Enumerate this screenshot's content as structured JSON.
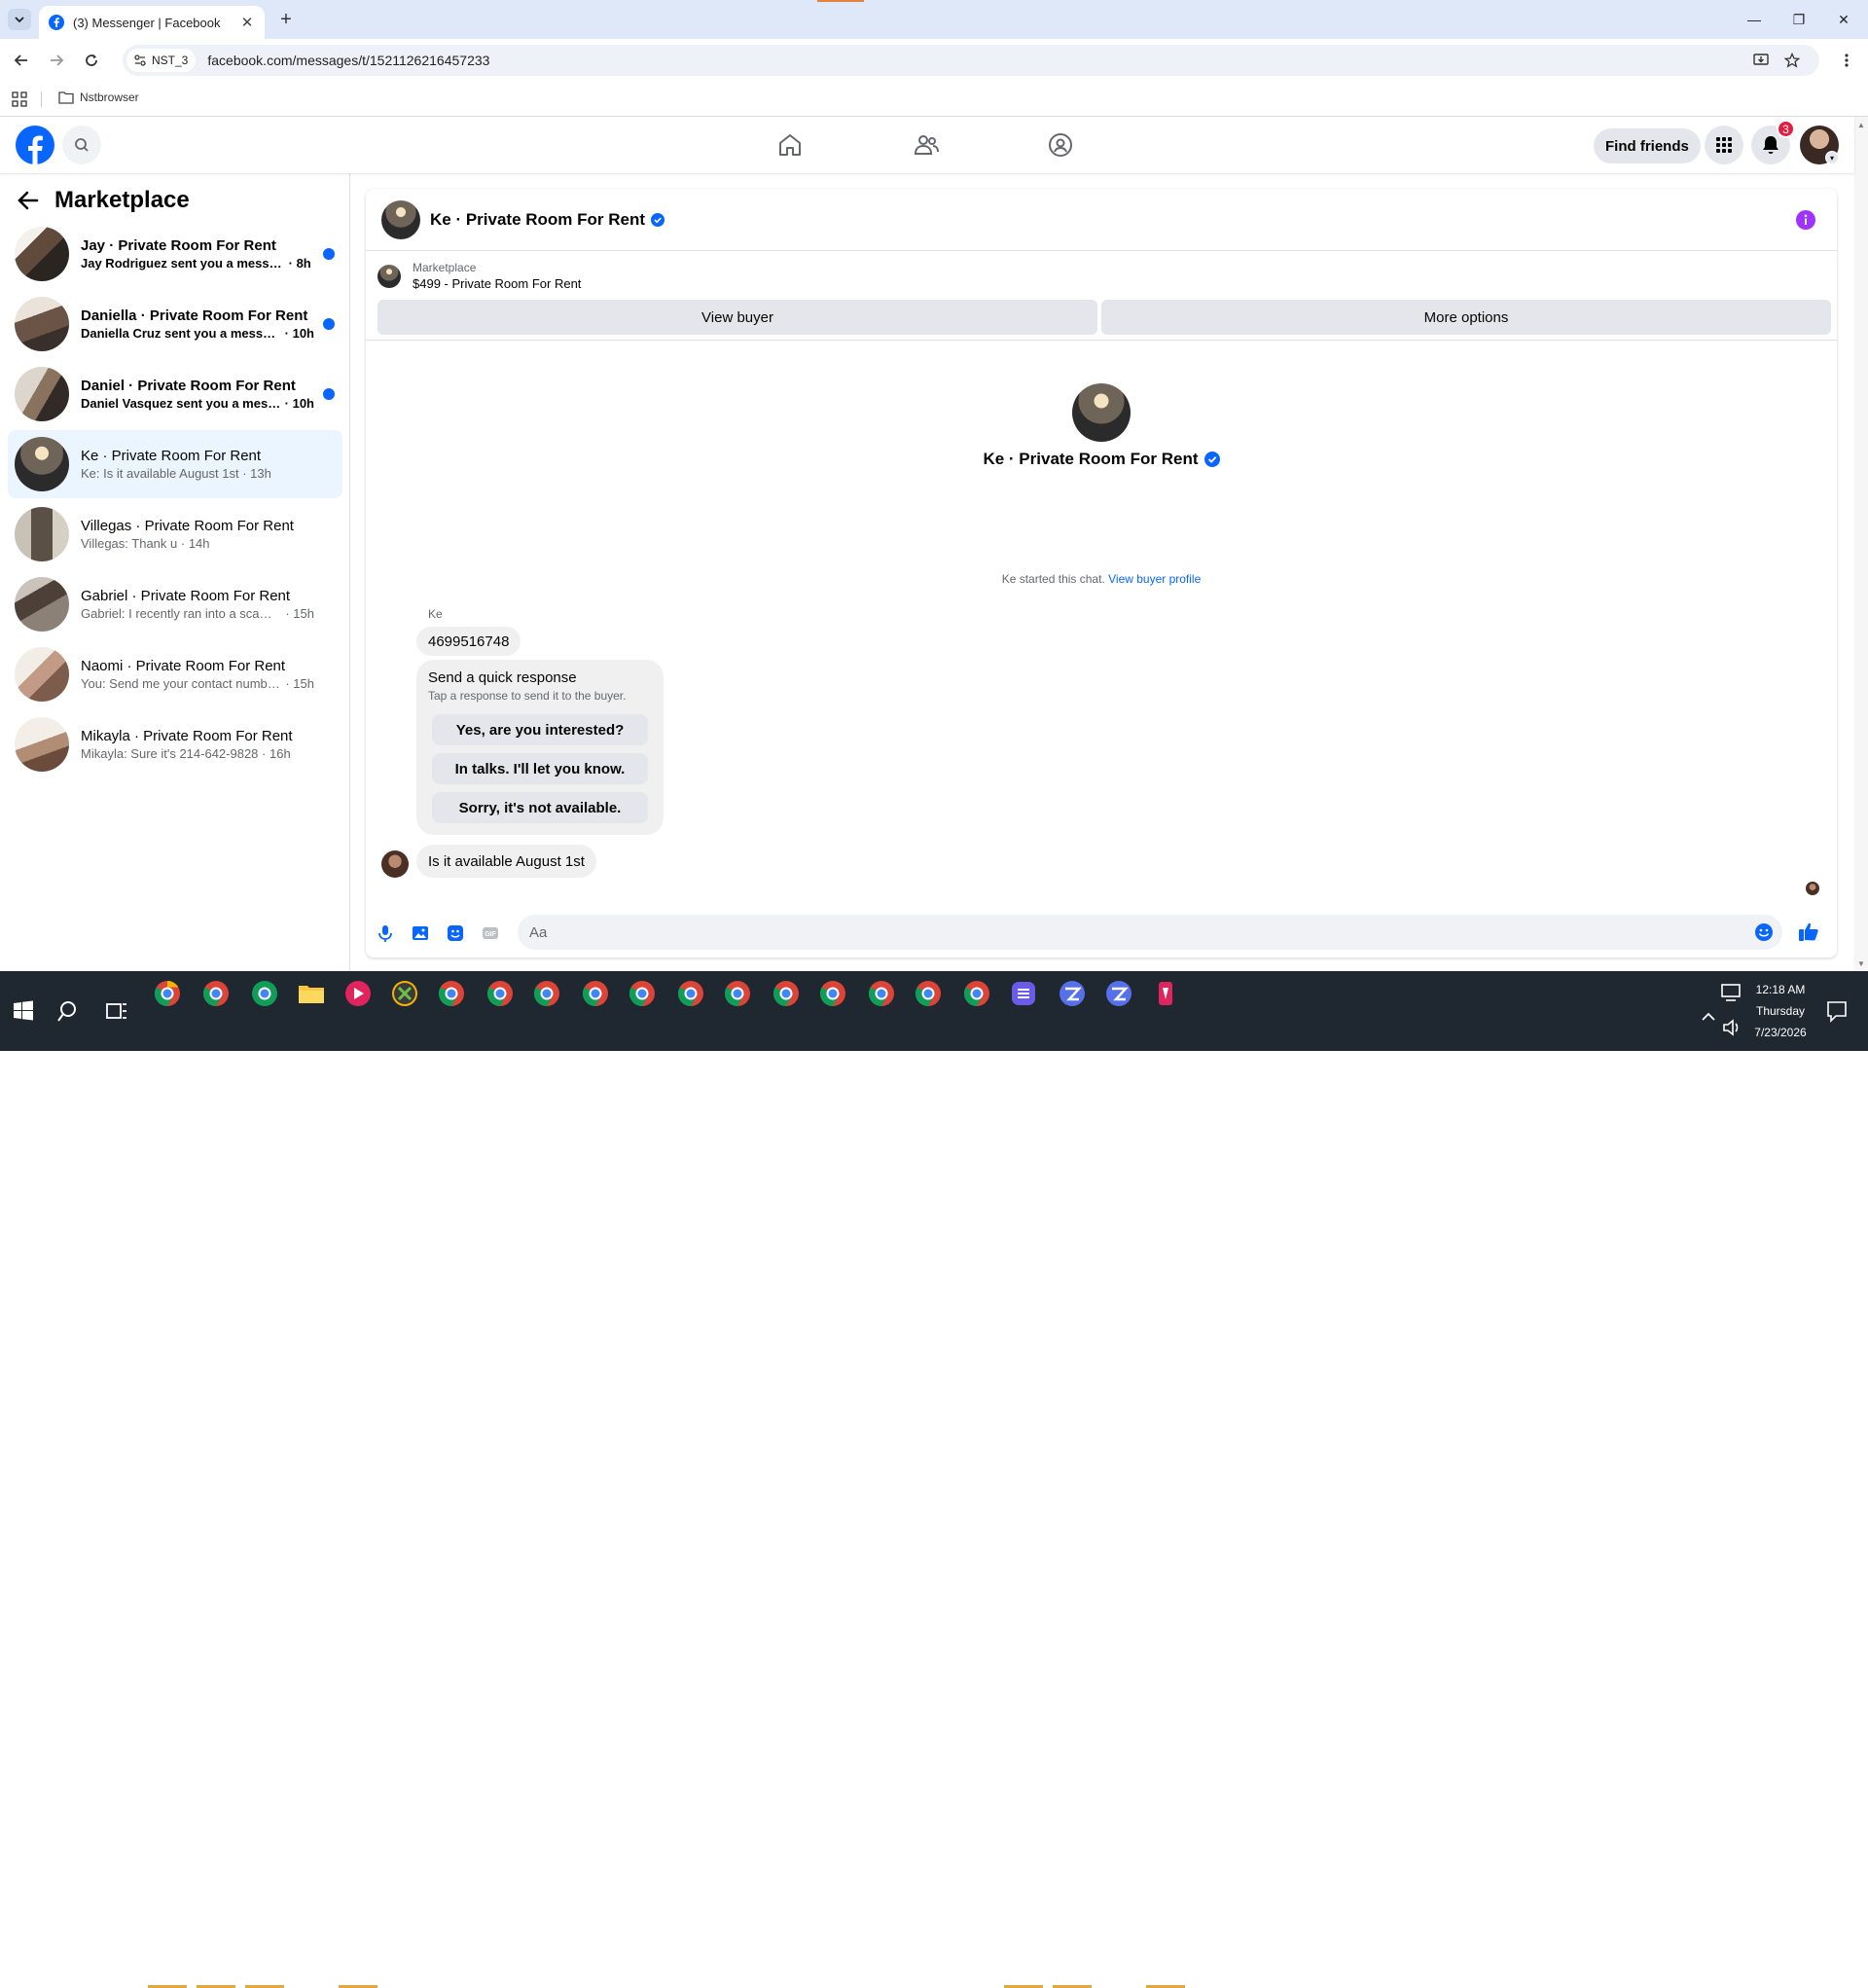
{
  "browser": {
    "tab_title": "(3) Messenger | Facebook",
    "profile_chip": "NST_3",
    "url": "facebook.com/messages/t/1521126216457233",
    "bookmark_folder": "Nstbrowser"
  },
  "header": {
    "find_friends": "Find friends",
    "notification_count": "3",
    "brand_color": "#0866ff"
  },
  "sidebar": {
    "title": "Marketplace",
    "conversations": [
      {
        "name": "Jay · Private Room For Rent",
        "preview": "Jay Rodriguez sent you a messag...",
        "time": "8h",
        "unread": true,
        "active": false
      },
      {
        "name": "Daniella · Private Room For Rent",
        "preview": "Daniella Cruz sent you a messag...",
        "time": "10h",
        "unread": true,
        "active": false
      },
      {
        "name": "Daniel · Private Room For Rent",
        "preview": "Daniel Vasquez sent you a mess...",
        "time": "10h",
        "unread": true,
        "active": false
      },
      {
        "name": "Ke · Private Room For Rent",
        "preview": "Ke: Is it available August 1st",
        "time": "13h",
        "unread": false,
        "active": true
      },
      {
        "name": "Villegas · Private Room For Rent",
        "preview": "Villegas: Thank u",
        "time": "14h",
        "unread": false,
        "active": false
      },
      {
        "name": "Gabriel · Private Room For Rent",
        "preview": "Gabriel: I recently ran into a scamm...",
        "time": "15h",
        "unread": false,
        "active": false
      },
      {
        "name": "Naomi · Private Room For Rent",
        "preview": "You: Send me your contact number...",
        "time": "15h",
        "unread": false,
        "active": false
      },
      {
        "name": "Mikayla · Private Room For Rent",
        "preview": "Mikayla: Sure it's 214-642-9828",
        "time": "16h",
        "unread": false,
        "active": false
      }
    ]
  },
  "chat": {
    "title": "Ke · Private Room For Rent",
    "marketplace_label": "Marketplace",
    "listing": "$499 - Private Room For Rent",
    "view_buyer": "View buyer",
    "more_options": "More options",
    "hero_name": "Ke · Private Room For Rent",
    "started_text": "Ke started this chat.",
    "view_buyer_profile": "View buyer profile",
    "sender": "Ke",
    "messages": [
      {
        "text": "4699516748"
      },
      {
        "text": "Is it available August 1st"
      }
    ],
    "quick_response": {
      "title": "Send a quick response",
      "subtitle": "Tap a response to send it to the buyer.",
      "options": [
        "Yes, are you interested?",
        "In talks. I'll let you know.",
        "Sorry, it's not available."
      ]
    },
    "composer_placeholder": "Aa"
  },
  "taskbar": {
    "time": "12:18 AM",
    "day": "Thursday",
    "date": "7/23/2026"
  }
}
